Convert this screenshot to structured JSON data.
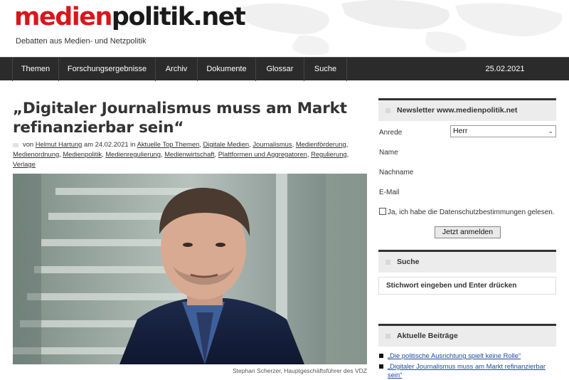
{
  "header": {
    "logo_part1": "medien",
    "logo_part2": "politik.net",
    "tagline": "Debatten aus Medien- und Netzpolitik"
  },
  "nav": {
    "items": [
      "Themen",
      "Forschungsergebnisse",
      "Archiv",
      "Dokumente",
      "Glossar",
      "Suche"
    ],
    "date": "25.02.2021"
  },
  "article": {
    "title": "„Digitaler Journalismus muss am Markt refinanzierbar sein“",
    "meta_prefix": "von",
    "author": "Helmut Hartung",
    "meta_on": "am",
    "date": "24.02.2021",
    "meta_in": "in",
    "categories": [
      "Aktuelle Top Themen",
      "Digitale Medien",
      "Journalismus",
      "Medienförderung",
      "Medienordnung",
      "Medienpolitik",
      "Medienregulierung",
      "Medienwirtschaft",
      "Plattformen und Aggregatoren",
      "Regulierung",
      "Verlage"
    ],
    "caption": "Stephan Scherzer, Hauptgeschäftsführer des VDZ"
  },
  "newsletter": {
    "title": "Newsletter www.medienpolitik.net",
    "anrede_label": "Anrede",
    "anrede_value": "Herr",
    "name_label": "Name",
    "nachname_label": "Nachname",
    "email_label": "E-Mail",
    "consent_label": "Ja, ich habe die Datenschutzbestimmungen gelesen.",
    "submit_label": "Jetzt anmelden"
  },
  "search": {
    "title": "Suche",
    "placeholder": "Stichwort eingeben und Enter drücken"
  },
  "recent": {
    "title": "Aktuelle Beiträge",
    "items": [
      "„Die politische Ausrichtung spielt keine Rolle“",
      "„Digitaler Journalismus muss am Markt refinanzierbar sein“"
    ]
  }
}
